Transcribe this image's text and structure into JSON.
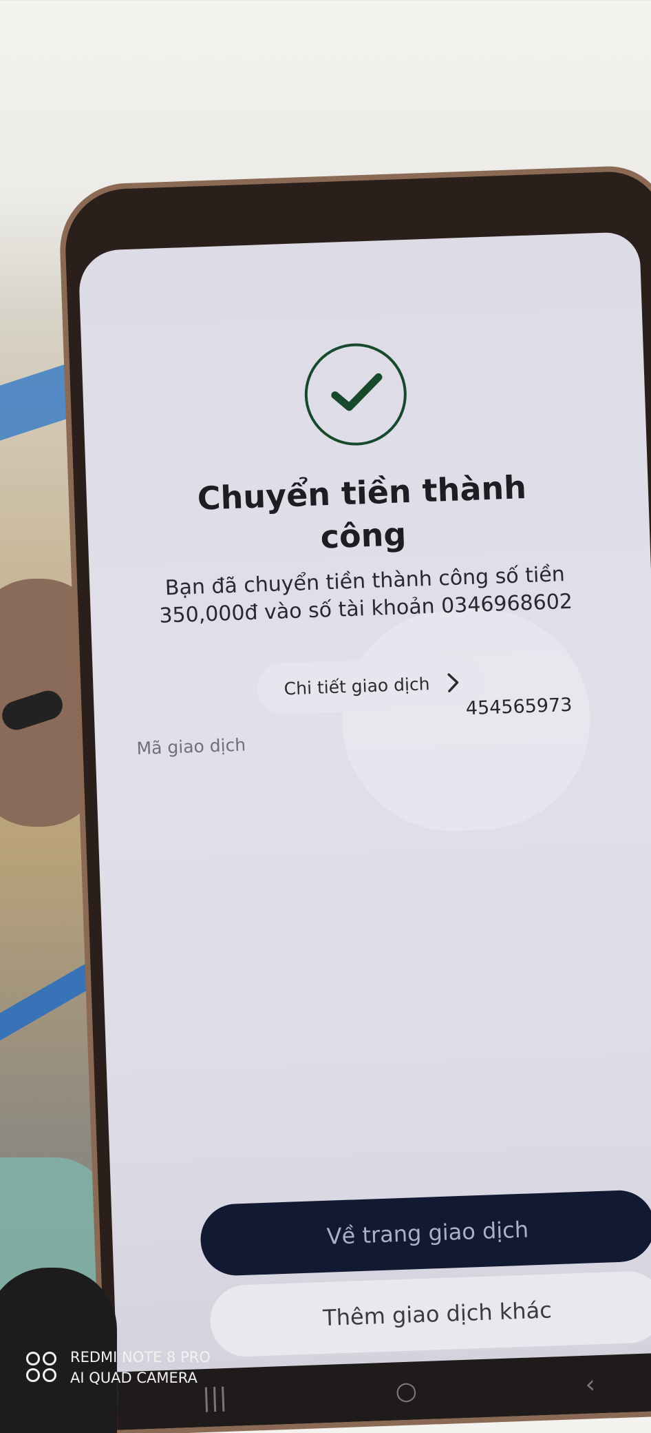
{
  "screen": {
    "title": "Chuyển tiền thành công",
    "description": "Bạn đã chuyển tiền thành công số tiền 350,000đ vào số tài khoản 0346968602",
    "detail_label": "Chi tiết giao dịch",
    "transaction_code_label": "Mã giao dịch",
    "transaction_code_value": "454565973",
    "primary_button": "Về trang giao dịch",
    "secondary_button": "Thêm giao dịch khác",
    "icons": {
      "success": "check-circle-icon",
      "detail": "chevron-right-icon"
    },
    "colors": {
      "success": "#174a2c",
      "primary_button": "#111933"
    }
  },
  "navbar": {
    "recents": "|||",
    "home": "○",
    "back": "‹"
  },
  "watermark": {
    "line1": "REDMI NOTE 8 PRO",
    "line2": "AI QUAD CAMERA"
  }
}
